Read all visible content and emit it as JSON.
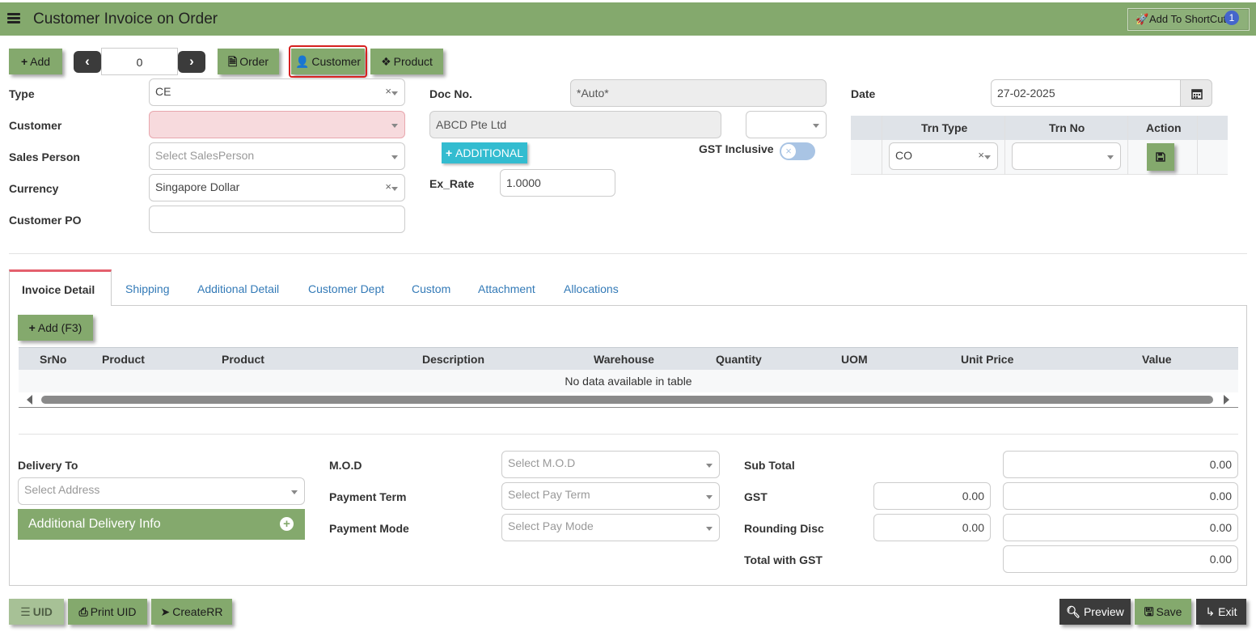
{
  "header": {
    "title": "Customer Invoice on Order",
    "shortcut_label": "Add To ShortCut",
    "shortcut_badge": "1"
  },
  "toolbar": {
    "add": "Add",
    "record_no": "0",
    "order": "Order",
    "customer": "Customer",
    "product": "Product"
  },
  "form": {
    "type_label": "Type",
    "type_value": "CE",
    "customer_label": "Customer",
    "customer_value": "",
    "sales_person_label": "Sales Person",
    "sales_person_placeholder": "Select SalesPerson",
    "currency_label": "Currency",
    "currency_value": "Singapore Dollar",
    "customer_po_label": "Customer PO",
    "customer_po_value": "",
    "doc_no_label": "Doc No.",
    "doc_no_value": "*Auto*",
    "customer_name_value": "ABCD Pte Ltd",
    "additional_label": "ADDITIONAL",
    "gst_inclusive_label": "GST Inclusive",
    "ex_rate_label": "Ex_Rate",
    "ex_rate_value": "1.0000",
    "date_label": "Date",
    "date_value": "27-02-2025"
  },
  "trn_table": {
    "columns": [
      "Trn Type",
      "Trn No",
      "Action"
    ],
    "trn_type_value": "CO"
  },
  "tabs": [
    "Invoice Detail",
    "Shipping",
    "Additional Detail",
    "Customer Dept",
    "Custom",
    "Attachment",
    "Allocations"
  ],
  "detail": {
    "add_label": "Add (F3)",
    "columns": [
      "SrNo",
      "Product",
      "Product",
      "Description",
      "Warehouse",
      "Quantity",
      "UOM",
      "Unit Price",
      "Value"
    ],
    "empty_message": "No data available in table"
  },
  "footer_form": {
    "delivery_to_label": "Delivery To",
    "delivery_placeholder": "Select Address",
    "additional_delivery_label": "Additional Delivery Info",
    "mod_label": "M.O.D",
    "mod_placeholder": "Select M.O.D",
    "payment_term_label": "Payment Term",
    "payment_term_placeholder": "Select Pay Term",
    "payment_mode_label": "Payment Mode",
    "payment_mode_placeholder": "Select Pay Mode",
    "sub_total_label": "Sub Total",
    "sub_total_value": "0.00",
    "gst_label": "GST",
    "gst_rate_value": "0.00",
    "gst_value": "0.00",
    "rounding_label": "Rounding Disc",
    "rounding_rate_value": "0.00",
    "rounding_value": "0.00",
    "total_label": "Total with GST",
    "total_value": "0.00"
  },
  "bottom_bar": {
    "uid": "UID",
    "print_uid": "Print UID",
    "create_rr": "CreateRR",
    "preview": "Preview",
    "save": "Save",
    "exit": "Exit"
  },
  "colors": {
    "brand_green": "#84a96d",
    "required_bg": "#f7dadd",
    "accent_cyan": "#33bcd0",
    "tab_accent": "#e4606d"
  }
}
